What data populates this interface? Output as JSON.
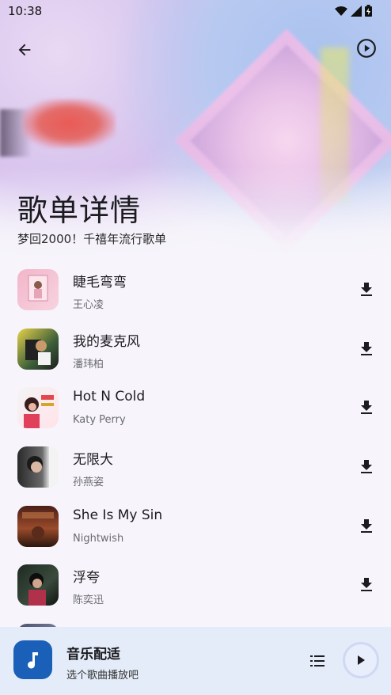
{
  "status_bar": {
    "time": "10:38"
  },
  "header": {
    "title": "歌单详情",
    "subtitle": "梦回2000！千禧年流行歌单"
  },
  "icons": {
    "back": "arrow-back-icon",
    "play_all": "play-circle-icon",
    "download": "download-icon",
    "note": "music-note-icon",
    "queue": "queue-list-icon",
    "play": "play-icon"
  },
  "songs": [
    {
      "name": "睫毛弯弯",
      "artist": "王心凌"
    },
    {
      "name": "我的麦克风",
      "artist": "潘玮柏"
    },
    {
      "name": "Hot N Cold",
      "artist": "Katy Perry"
    },
    {
      "name": "无限大",
      "artist": "孙燕姿"
    },
    {
      "name": "She Is My Sin",
      "artist": "Nightwish"
    },
    {
      "name": "浮夸",
      "artist": "陈奕迅"
    }
  ],
  "player": {
    "title": "音乐配适",
    "subtitle": "选个歌曲播放吧"
  },
  "colors": {
    "accent": "#1a5fb8",
    "player_bg": "#e3ecf8",
    "page_bg": "#f7f5fb"
  }
}
